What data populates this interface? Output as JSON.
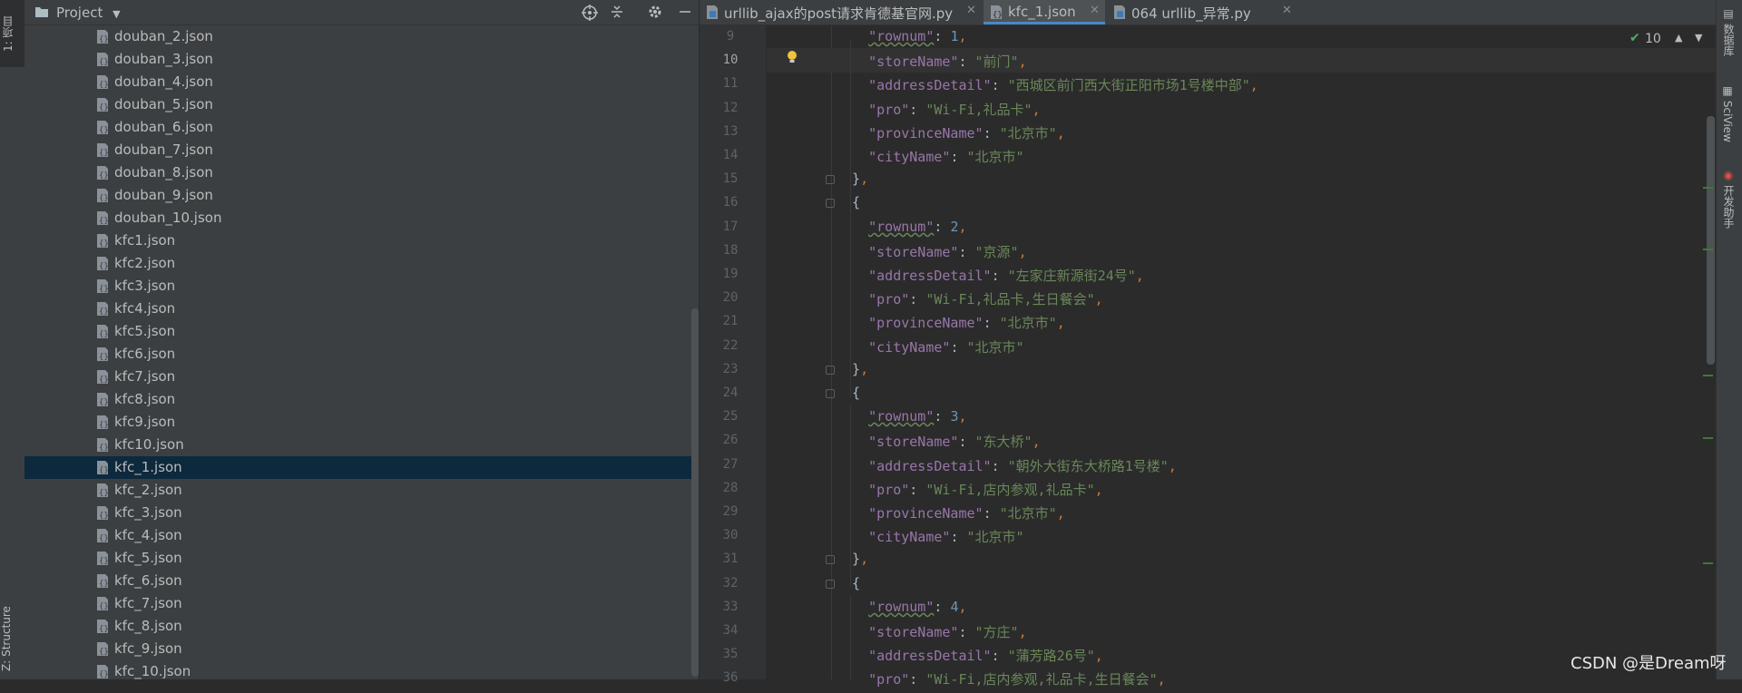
{
  "left_strip": {
    "project_tab": "1: 项目",
    "structure_tab": "Z: Structure"
  },
  "project_panel": {
    "title": "Project",
    "files": [
      "douban_2.json",
      "douban_3.json",
      "douban_4.json",
      "douban_5.json",
      "douban_6.json",
      "douban_7.json",
      "douban_8.json",
      "douban_9.json",
      "douban_10.json",
      "kfc1.json",
      "kfc2.json",
      "kfc3.json",
      "kfc4.json",
      "kfc5.json",
      "kfc6.json",
      "kfc7.json",
      "kfc8.json",
      "kfc9.json",
      "kfc10.json",
      "kfc_1.json",
      "kfc_2.json",
      "kfc_3.json",
      "kfc_4.json",
      "kfc_5.json",
      "kfc_6.json",
      "kfc_7.json",
      "kfc_8.json",
      "kfc_9.json",
      "kfc_10.json"
    ],
    "selected": "kfc_1.json"
  },
  "tabs": [
    {
      "label": "urllib_ajax的post请求肯德基官网.py",
      "active": false
    },
    {
      "label": "kfc_1.json",
      "active": true
    },
    {
      "label": "064 urllib_异常.py",
      "active": false
    }
  ],
  "inspection": {
    "count": "10"
  },
  "editor": {
    "current_line": 10,
    "lines": [
      {
        "no": "9",
        "text": "    \"rownum\": 1,"
      },
      {
        "no": "10",
        "text": "    \"storeName\": \"前门\","
      },
      {
        "no": "11",
        "text": "    \"addressDetail\": \"西城区前门西大街正阳市场1号楼中部\","
      },
      {
        "no": "12",
        "text": "    \"pro\": \"Wi-Fi,礼品卡\","
      },
      {
        "no": "13",
        "text": "    \"provinceName\": \"北京市\","
      },
      {
        "no": "14",
        "text": "    \"cityName\": \"北京市\""
      },
      {
        "no": "15",
        "text": "  },"
      },
      {
        "no": "16",
        "text": "  {"
      },
      {
        "no": "17",
        "text": "    \"rownum\": 2,"
      },
      {
        "no": "18",
        "text": "    \"storeName\": \"京源\","
      },
      {
        "no": "19",
        "text": "    \"addressDetail\": \"左家庄新源街24号\","
      },
      {
        "no": "20",
        "text": "    \"pro\": \"Wi-Fi,礼品卡,生日餐会\","
      },
      {
        "no": "21",
        "text": "    \"provinceName\": \"北京市\","
      },
      {
        "no": "22",
        "text": "    \"cityName\": \"北京市\""
      },
      {
        "no": "23",
        "text": "  },"
      },
      {
        "no": "24",
        "text": "  {"
      },
      {
        "no": "25",
        "text": "    \"rownum\": 3,"
      },
      {
        "no": "26",
        "text": "    \"storeName\": \"东大桥\","
      },
      {
        "no": "27",
        "text": "    \"addressDetail\": \"朝外大街东大桥路1号楼\","
      },
      {
        "no": "28",
        "text": "    \"pro\": \"Wi-Fi,店内参观,礼品卡\","
      },
      {
        "no": "29",
        "text": "    \"provinceName\": \"北京市\","
      },
      {
        "no": "30",
        "text": "    \"cityName\": \"北京市\""
      },
      {
        "no": "31",
        "text": "  },"
      },
      {
        "no": "32",
        "text": "  {"
      },
      {
        "no": "33",
        "text": "    \"rownum\": 4,"
      },
      {
        "no": "34",
        "text": "    \"storeName\": \"方庄\","
      },
      {
        "no": "35",
        "text": "    \"addressDetail\": \"蒲芳路26号\","
      },
      {
        "no": "36",
        "text": "    \"pro\": \"Wi-Fi,店内参观,礼品卡,生日餐会\","
      }
    ]
  },
  "right_strip": {
    "database_tab": "数据库",
    "sciview_tab": "SciView",
    "helper_tab": "开发助手"
  },
  "watermark": "CSDN @是Dream呀",
  "colors": {
    "accent": "#4a88c7",
    "selection": "#0d293e",
    "string": "#6a8759",
    "key": "#9876aa",
    "number": "#6897bb"
  }
}
